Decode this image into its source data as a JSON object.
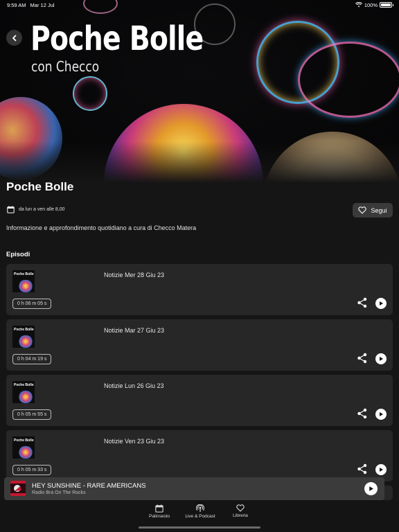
{
  "status_bar": {
    "time": "9:59 AM",
    "date": "Mar 12 Jul",
    "battery": "100%"
  },
  "hero": {
    "title": "Poche Bolle",
    "subtitle": "con Checco"
  },
  "show": {
    "title": "Poche Bolle",
    "schedule": "da lun a ven alle 8,00",
    "follow_label": "Segui",
    "description": "Informazione e approfondimento quotidiano a cura di Checco Matera"
  },
  "episodes_section": {
    "title": "Episodi",
    "thumb_label": "Poche Bolle",
    "items": [
      {
        "title": "Notizie Mer 28 Giu 23",
        "duration": "0 h 06 m 05 s"
      },
      {
        "title": "Notizie Mar 27 Giu 23",
        "duration": "0 h 04 m 19 s"
      },
      {
        "title": "Notizie Lun 26 Giu 23",
        "duration": "0 h 05 m 55 s"
      },
      {
        "title": "Notizie Ven 23 Giu 23",
        "duration": "0 h 05 m 33 s"
      }
    ]
  },
  "now_playing": {
    "title": "HEY SUNSHINE - RARE AMERICANS",
    "subtitle": "Radio Bra On The Rocks"
  },
  "tabs": [
    {
      "label": "Palinsesto",
      "icon": "calendar-icon"
    },
    {
      "label": "Live & Podcast",
      "icon": "podcast-icon"
    },
    {
      "label": "Libreria",
      "icon": "heart-icon"
    }
  ],
  "colors": {
    "background": "#151515",
    "card": "#272727",
    "player": "#3b3b3b",
    "accent": "#ffffff"
  }
}
